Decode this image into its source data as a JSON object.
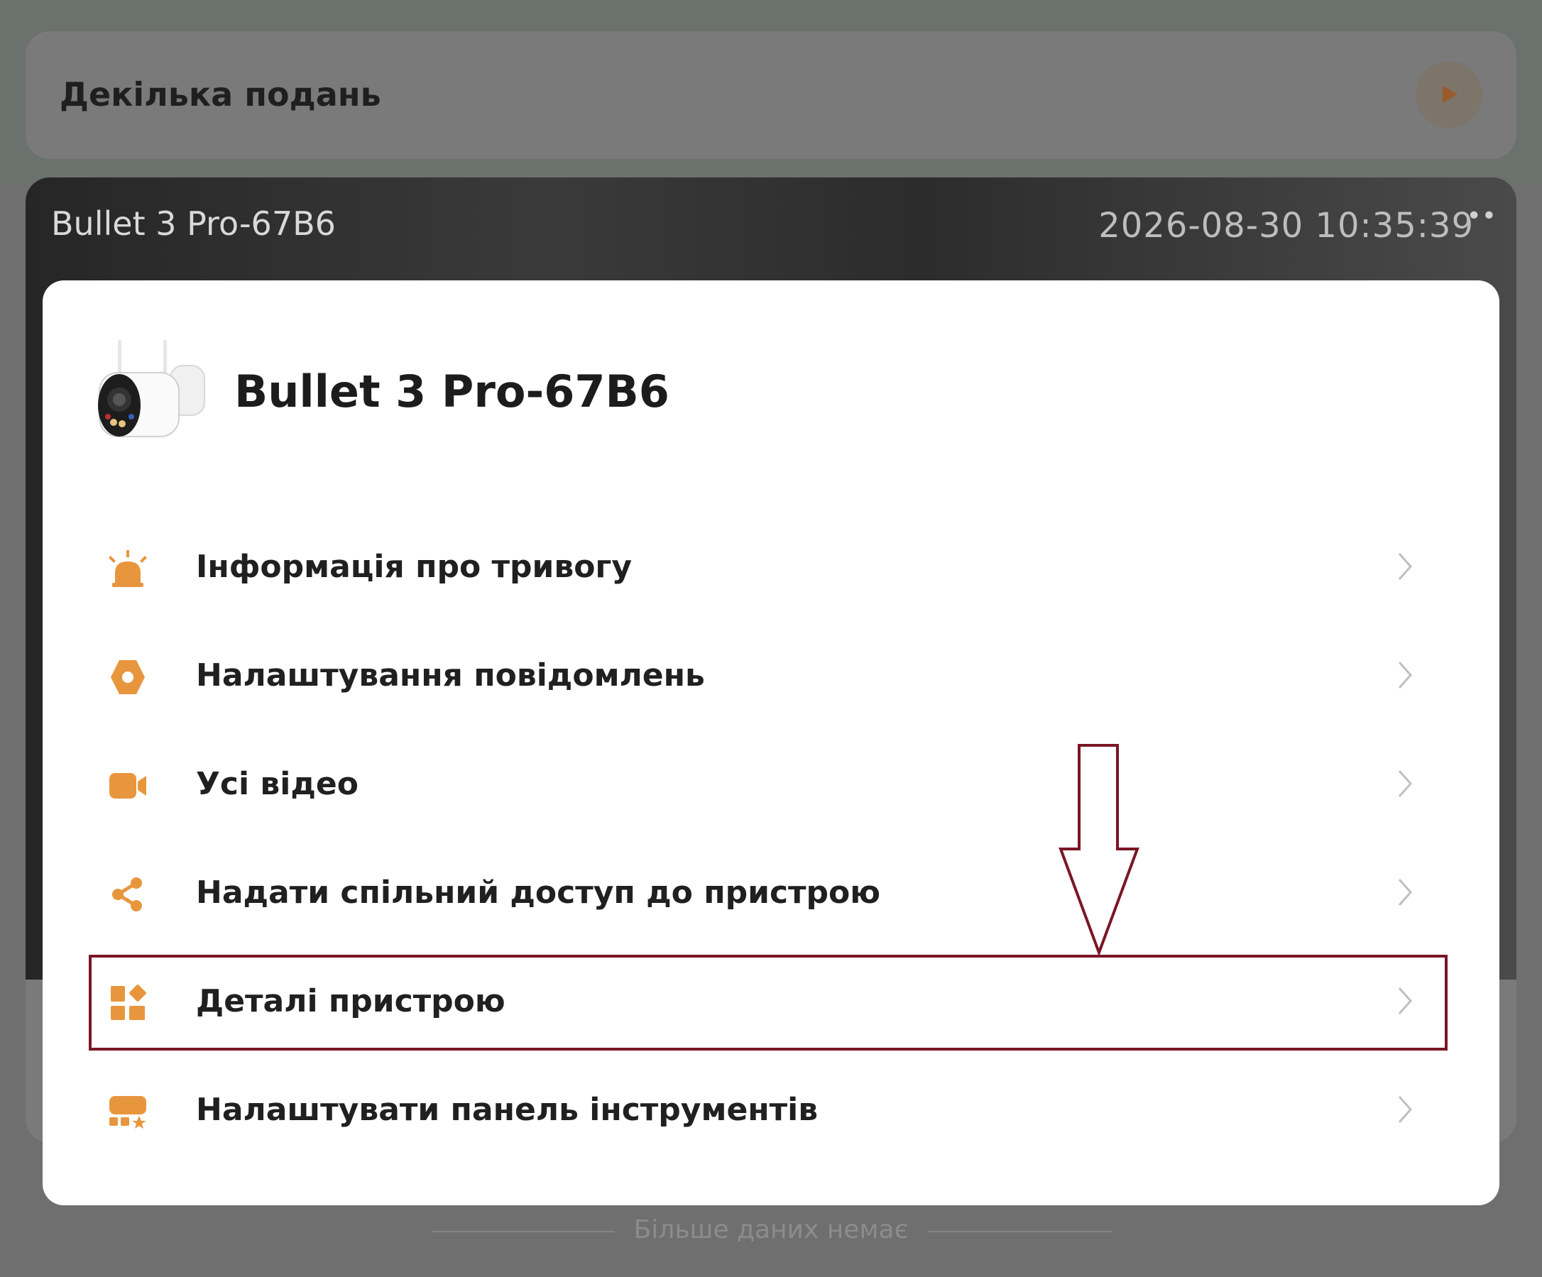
{
  "background": {
    "multi_view_card": {
      "title": "Декілька подань"
    },
    "camera_card": {
      "name": "Bullet  3 Pro-67B6",
      "timestamp": "2026-08-30 10:35:39"
    },
    "footer_text": "Більше даних немає"
  },
  "sheet": {
    "device_title": "Bullet  3 Pro-67B6",
    "menu": [
      {
        "label": "Інформація про тривогу",
        "icon": "alarm-icon"
      },
      {
        "label": "Налаштування повідомлень",
        "icon": "settings-hexagon-icon"
      },
      {
        "label": "Усі відео",
        "icon": "video-camera-icon"
      },
      {
        "label": "Надати спільний доступ до пристрою",
        "icon": "share-icon"
      },
      {
        "label": "Деталі пристрою",
        "icon": "device-details-icon"
      },
      {
        "label": "Налаштувати панель інструментів",
        "icon": "toolbar-customize-icon"
      }
    ]
  },
  "colors": {
    "accent": "#e8963e",
    "annotation": "#7a1626",
    "text_primary": "#202020"
  }
}
